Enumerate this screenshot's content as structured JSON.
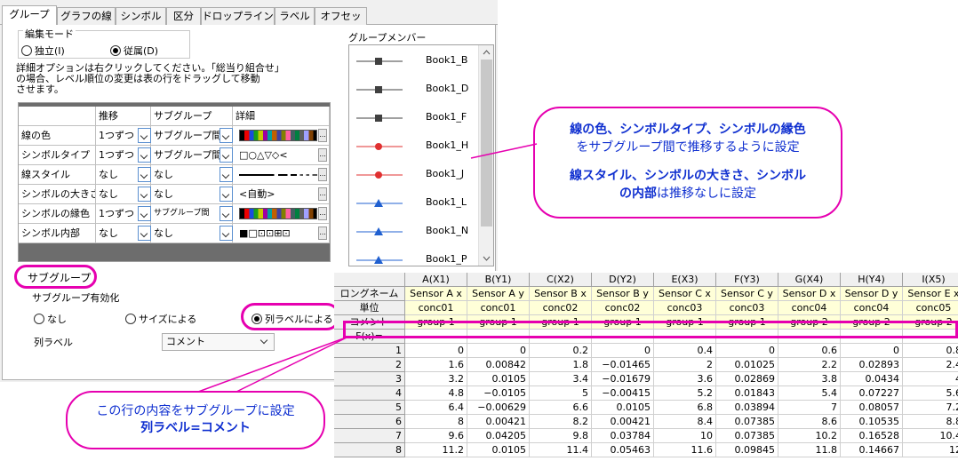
{
  "tabs": [
    "グループ",
    "グラフの線",
    "シンボル",
    "区分",
    "ドロップライン",
    "ラベル",
    "オフセット"
  ],
  "edit_mode": {
    "label": "編集モード",
    "options": [
      {
        "label": "独立(I)",
        "selected": false
      },
      {
        "label": "従属(D)",
        "selected": true
      }
    ]
  },
  "note": "詳細オプションは右クリックしてください。「総当り組合せ」の場合、レベル順位の変更は表の行をドラッグして移動させます。",
  "note_lines": [
    "詳細オプションは右クリックしてください。「総当り組合せ」",
    "の場合、レベル順位の変更は表の行をドラッグして移動",
    "させます。"
  ],
  "detail_table": {
    "headers": [
      "",
      "推移",
      "サブグループ",
      "詳細"
    ],
    "rows": [
      {
        "name": "線の色",
        "step": "1つずつ",
        "subgroup": "サブグループ間",
        "detail": "color-list"
      },
      {
        "name": "シンボルタイプ",
        "step": "1つずつ",
        "subgroup": "サブグループ間",
        "detail": "□○△▽◇<"
      },
      {
        "name": "線スタイル",
        "step": "なし",
        "subgroup": "なし",
        "detail": "line-style"
      },
      {
        "name": "シンボルの大きさ",
        "step": "なし",
        "subgroup": "なし",
        "detail": "<自動>"
      },
      {
        "name": "シンボルの縁色",
        "step": "1つずつ",
        "subgroup": "サブグループ間",
        "detail": "color-list"
      },
      {
        "name": "シンボル内部",
        "step": "なし",
        "subgroup": "なし",
        "detail": "■□⊡⊡⊞⊡"
      }
    ]
  },
  "group_members": {
    "label": "グループメンバー",
    "items": [
      {
        "name": "Book1_B",
        "color": "#404040",
        "symbol": "square"
      },
      {
        "name": "Book1_D",
        "color": "#404040",
        "symbol": "square"
      },
      {
        "name": "Book1_F",
        "color": "#404040",
        "symbol": "square"
      },
      {
        "name": "Book1_H",
        "color": "#e03030",
        "symbol": "circle"
      },
      {
        "name": "Book1_J",
        "color": "#e03030",
        "symbol": "circle"
      },
      {
        "name": "Book1_L",
        "color": "#2060d0",
        "symbol": "triangle"
      },
      {
        "name": "Book1_N",
        "color": "#2060d0",
        "symbol": "triangle"
      },
      {
        "name": "Book1_P",
        "color": "#2060d0",
        "symbol": "triangle"
      }
    ]
  },
  "subgroup": {
    "label": "サブグループ",
    "enable_label": "サブグループ有効化",
    "options": [
      {
        "label": "なし",
        "selected": false
      },
      {
        "label": "サイズによる",
        "selected": false
      },
      {
        "label": "列ラベルによる",
        "selected": true
      }
    ],
    "column_label": "列ラベル",
    "column_label_value": "コメント"
  },
  "callout_top": {
    "line1": "線の色、シンボルタイプ、シンボルの縁色",
    "line2": "をサブグループ間で推移するように設定",
    "line3": "線スタイル、シンボルの大きさ、シンボル",
    "line4_bold": "の内部",
    "line4_rest": "は推移なしに設定"
  },
  "callout_bottom": {
    "line1": "この行の内容をサブグループに設定",
    "line2": "列ラベル=コメント"
  },
  "worksheet": {
    "corner": " ",
    "row_labels": [
      "ロングネーム",
      "単位",
      "コメント",
      "F(x)="
    ],
    "columns": [
      {
        "header": "A(X1)",
        "long": "Sensor A x",
        "unit": "conc01",
        "comment": "group 1"
      },
      {
        "header": "B(Y1)",
        "long": "Sensor A y",
        "unit": "conc01",
        "comment": "group 1"
      },
      {
        "header": "C(X2)",
        "long": "Sensor B x",
        "unit": "conc02",
        "comment": "group 1"
      },
      {
        "header": "D(Y2)",
        "long": "Sensor B y",
        "unit": "conc02",
        "comment": "group 1"
      },
      {
        "header": "E(X3)",
        "long": "Sensor C x",
        "unit": "conc03",
        "comment": "group 1"
      },
      {
        "header": "F(Y3)",
        "long": "Sensor C y",
        "unit": "conc03",
        "comment": "group 1"
      },
      {
        "header": "G(X4)",
        "long": "Sensor D x",
        "unit": "conc04",
        "comment": "group 2"
      },
      {
        "header": "H(Y4)",
        "long": "Sensor D y",
        "unit": "conc04",
        "comment": "group 2"
      },
      {
        "header": "I(X5)",
        "long": "Sensor E x",
        "unit": "conc05",
        "comment": "group 2"
      }
    ],
    "rows": [
      [
        "1",
        "0",
        "0",
        "0.2",
        "0",
        "0.4",
        "0",
        "0.6",
        "0",
        "0.8"
      ],
      [
        "2",
        "1.6",
        "0.00842",
        "1.8",
        "−0.01465",
        "2",
        "0.01025",
        "2.2",
        "0.02893",
        "2.4"
      ],
      [
        "3",
        "3.2",
        "0.0105",
        "3.4",
        "−0.01679",
        "3.6",
        "0.02869",
        "3.8",
        "0.0434",
        "4"
      ],
      [
        "4",
        "4.8",
        "−0.0105",
        "5",
        "−0.00415",
        "5.2",
        "0.01843",
        "5.4",
        "0.07227",
        "5.6"
      ],
      [
        "5",
        "6.4",
        "−0.00629",
        "6.6",
        "0.0105",
        "6.8",
        "0.03894",
        "7",
        "0.08057",
        "7.2"
      ],
      [
        "6",
        "8",
        "0.00421",
        "8.2",
        "0.00421",
        "8.4",
        "0.07385",
        "8.6",
        "0.10535",
        "8.8"
      ],
      [
        "7",
        "9.6",
        "0.04205",
        "9.8",
        "0.03784",
        "10",
        "0.07385",
        "10.2",
        "0.16528",
        "10.4"
      ],
      [
        "8",
        "11.2",
        "0.0105",
        "11.4",
        "0.05463",
        "11.6",
        "0.09845",
        "11.8",
        "0.14667",
        "12"
      ]
    ]
  },
  "colors": {
    "accent_pink": "#e600b0",
    "callout_text": "#1030d0",
    "comment_fill": "#ffffd8"
  }
}
